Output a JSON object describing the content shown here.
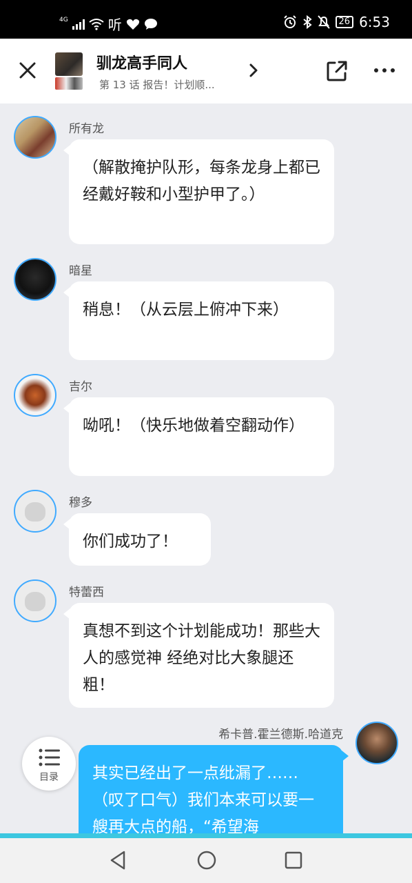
{
  "status": {
    "network": "4G",
    "extra": "听",
    "battery": "26",
    "time": "6:53"
  },
  "header": {
    "title": "驯龙高手同人",
    "subtitle": "第 13 话 报告！计划顺..."
  },
  "messages": [
    {
      "name": "所有龙",
      "text": "（解散掩护队形，每条龙身上都已经戴好鞍和小型护甲了。）"
    },
    {
      "name": "暗星",
      "text": "稍息！（从云层上俯冲下来）"
    },
    {
      "name": "吉尔",
      "text": "呦吼！（快乐地做着空翻动作）"
    },
    {
      "name": "穆多",
      "text": "你们成功了！"
    },
    {
      "name": "特蕾西",
      "text": "真想不到这个计划能成功！那些大人的感觉神 经绝对比大象腿还粗！"
    },
    {
      "name": "希卡普.霍兰德斯.哈道克",
      "text": "其实已经出了一点纰漏了……（叹了口气）我们本来可以要一艘再大点的船，“希望海"
    }
  ],
  "toc": {
    "label": "目录"
  },
  "colors": {
    "accent": "#2bb8ff",
    "avatar_ring": "#40aaff",
    "progress": "#3cc7e0"
  }
}
